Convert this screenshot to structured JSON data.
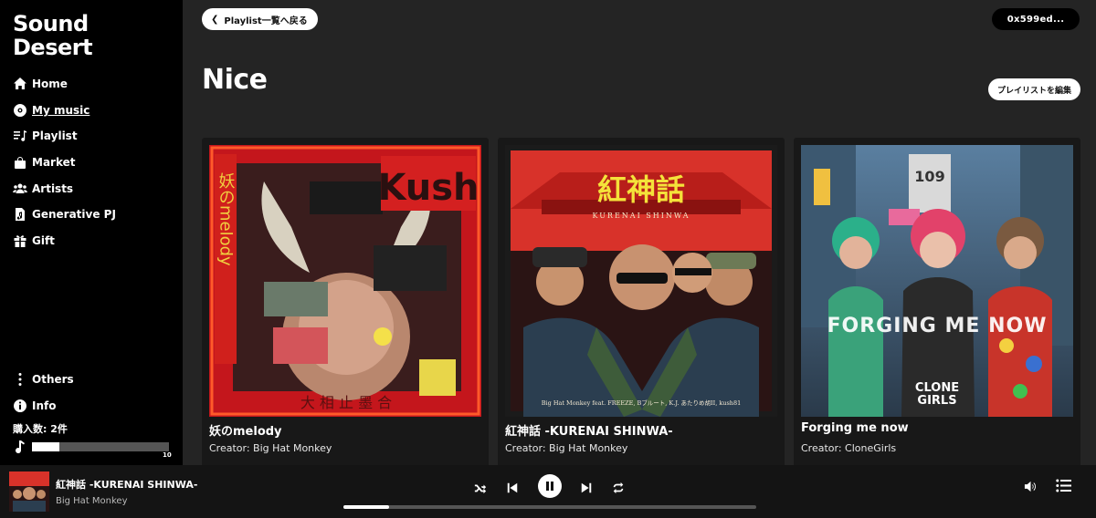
{
  "logo": {
    "line1": "Sound",
    "line2": "Desert"
  },
  "nav": {
    "items": [
      {
        "label": "Home",
        "icon": "home-icon"
      },
      {
        "label": "My music",
        "icon": "disc-icon",
        "active": true
      },
      {
        "label": "Playlist",
        "icon": "playlist-icon"
      },
      {
        "label": "Market",
        "icon": "bag-icon"
      },
      {
        "label": "Artists",
        "icon": "users-icon"
      },
      {
        "label": "Generative PJ",
        "icon": "music-file-icon"
      },
      {
        "label": "Gift",
        "icon": "gift-icon"
      }
    ],
    "bottom": [
      {
        "label": "Others",
        "icon": "more-vertical-icon"
      },
      {
        "label": "Info",
        "icon": "info-icon"
      }
    ]
  },
  "purchase": {
    "label": "購入数: 2件",
    "max": "10",
    "fill_fraction": 0.2
  },
  "header": {
    "back_label": "Playlist一覧へ戻る",
    "wallet": "0x599ed..."
  },
  "playlist": {
    "title": "Nice",
    "edit_label": "プレイリストを編集"
  },
  "cards": [
    {
      "title": "妖のmelody",
      "creator": "Creator: Big Hat Monkey"
    },
    {
      "title": "紅神話 -KURENAI SHINWA-",
      "creator": "Creator: Big Hat Monkey"
    },
    {
      "title": "Forging me now",
      "creator": "Creator: CloneGirls"
    }
  ],
  "art": {
    "card1": {
      "side": "妖のmelody",
      "kush": "Kush",
      "bottom": "大 相 止 墨 合"
    },
    "card2": {
      "title": "紅神話",
      "sub": "KURENAI SHINWA",
      "credits": "Big Hat Monkey feat. FREEZE, Bブルート, K.J. あたりめ胡II, kush81"
    },
    "card3": {
      "main": "FORGING ME NOW",
      "brand1": "CLONE",
      "brand2": "GIRLS",
      "sign": "109"
    }
  },
  "player": {
    "title": "紅神話 -KURENAI SHINWA-",
    "artist": "Big Hat Monkey",
    "progress_fraction": 0.11
  },
  "colors": {
    "sidebar": "#000000",
    "main": "#242424",
    "card": "#181818",
    "player": "#141414"
  }
}
